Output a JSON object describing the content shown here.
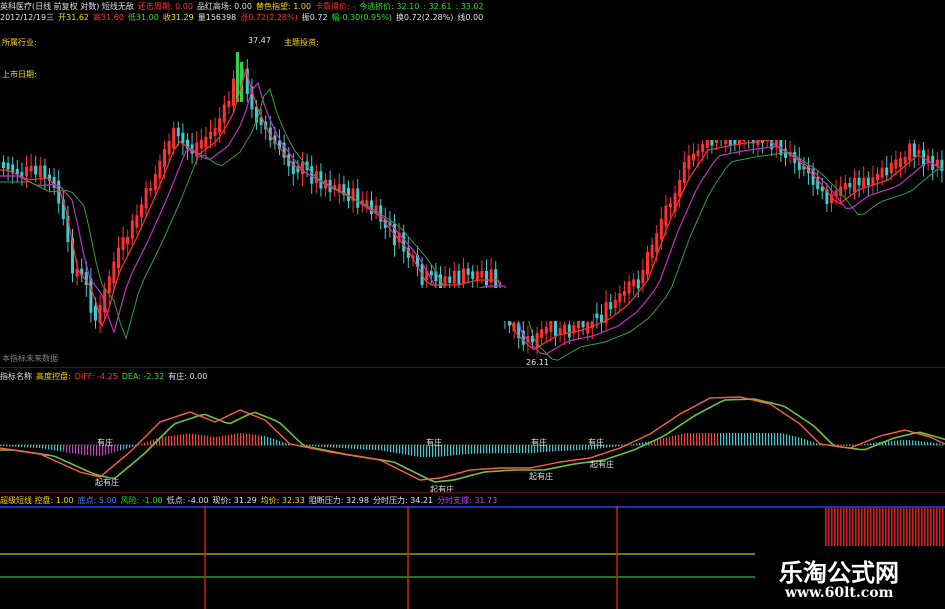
{
  "header": {
    "line1": [
      {
        "text": "英科医疗(日线 前复权 对数) 短线无敌",
        "color": "#e0e0e0"
      },
      {
        "text": "还击周期: 0.00",
        "color": "#ff3030"
      },
      {
        "text": "品红高场: 0.00",
        "color": "#e0e0e0"
      },
      {
        "text": "替色指望: 1.00",
        "color": "#ffd700"
      },
      {
        "text": "卡靠得价: -",
        "color": "#ff3030"
      },
      {
        "text": "今逃挤价: 32.10",
        "color": "#20e020"
      },
      {
        "text": ": 32.61",
        "color": "#20e020"
      },
      {
        "text": ": 33.02",
        "color": "#20e020"
      }
    ],
    "line2": [
      {
        "text": "2012/12/19三",
        "color": "#e0e0e0"
      },
      {
        "text": "开31.62",
        "color": "#ffd700"
      },
      {
        "text": "高31.60",
        "color": "#ff3030"
      },
      {
        "text": "低31.00",
        "color": "#20e020"
      },
      {
        "text": "收31.29",
        "color": "#ffd700"
      },
      {
        "text": "量156398",
        "color": "#e0e0e0"
      },
      {
        "text": "涨0.72(2.28%)",
        "color": "#ff3030"
      },
      {
        "text": "振0.72",
        "color": "#e0e0e0"
      },
      {
        "text": "幅-0.30(0.95%)",
        "color": "#20e020"
      },
      {
        "text": "换0.72(2.28%)",
        "color": "#e0e0e0"
      },
      {
        "text": "线0.00",
        "color": "#e0e0e0"
      }
    ]
  },
  "main_chart": {
    "labels": {
      "industry": "所属行业:",
      "theme": "主题投资:",
      "listing_date": "上市日期:",
      "footer": "本指标未来数据"
    },
    "high_label": "37.47",
    "low_label": "26.11"
  },
  "indicator1": {
    "header": [
      {
        "text": "指标名称",
        "color": "#e0e0e0"
      },
      {
        "text": "高度控盘:",
        "color": "#ffd700"
      },
      {
        "text": "DIFF: -4.25",
        "color": "#ff3030"
      },
      {
        "text": "DEA: -2.32",
        "color": "#20e020"
      },
      {
        "text": "有庄: 0.00",
        "color": "#e0e0e0"
      }
    ],
    "tags": {
      "youzhuang": "有庄",
      "youzhuang_b": "有庄",
      "youzhuang_c": "有庄",
      "youzhuang_d": "有庄",
      "qiyouzhuang": "起有庄",
      "qiyouzhuang_b": "起有庄",
      "qiyouzhuang_c": "起有庄",
      "qiyouzhuang_d": "起有庄"
    }
  },
  "indicator2": {
    "header": [
      {
        "text": "超级短线 控盘: 1.00",
        "color": "#ffd700"
      },
      {
        "text": "底点: 5.00",
        "color": "#4080ff"
      },
      {
        "text": "风险: -1.00",
        "color": "#20e020"
      },
      {
        "text": "低点: -4.00",
        "color": "#e0e0e0"
      },
      {
        "text": "现价: 31.29",
        "color": "#e0e0e0"
      },
      {
        "text": "均价: 32.33",
        "color": "#ffd700"
      },
      {
        "text": "阻断压力: 32.98",
        "color": "#e0e0e0"
      },
      {
        "text": "分时压力: 34.21",
        "color": "#e0e0e0"
      },
      {
        "text": "分时支撑: 31.73",
        "color": "#c040ff"
      }
    ]
  },
  "watermark": {
    "title": "乐淘公式网",
    "url": "www.60lt.com"
  },
  "colors": {
    "up": "#ff3030",
    "down": "#40c8d0",
    "ma_red": "#ff3030",
    "ma_magenta": "#c030c0",
    "ma_green": "#30a040",
    "separator": "#5a1010"
  }
}
